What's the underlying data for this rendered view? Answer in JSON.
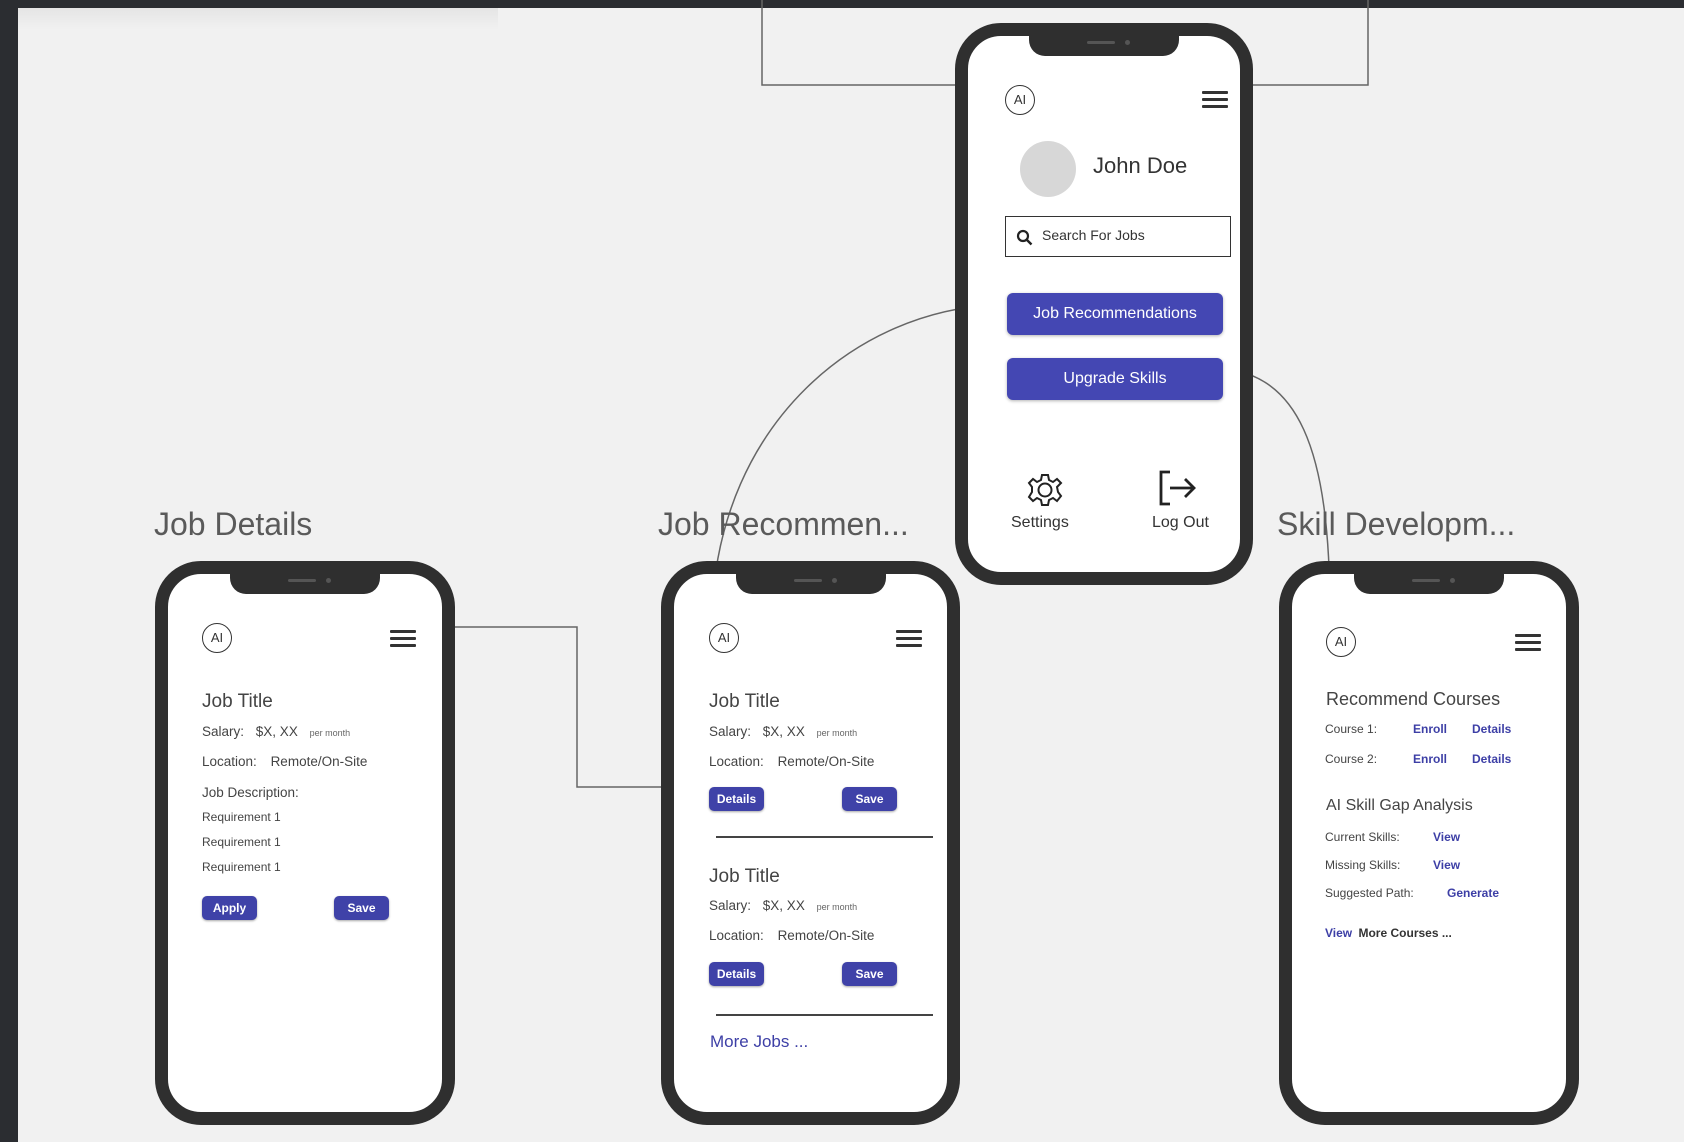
{
  "labels": {
    "job_details": "Job Details",
    "job_recommendations": "Job Recommen...",
    "skill_development": "Skill Developm..."
  },
  "home": {
    "logo": "AI",
    "user_name": "John Doe",
    "search_placeholder": "Search For Jobs",
    "btn_job_recs": "Job Recommendations",
    "btn_upgrade": "Upgrade Skills",
    "settings_label": "Settings",
    "logout_label": "Log Out"
  },
  "job_details": {
    "logo": "AI",
    "title": "Job Title",
    "salary_label": "Salary:",
    "salary_value": "$X, XX",
    "salary_unit": "per month",
    "location_label": "Location:",
    "location_value": "Remote/On-Site",
    "description_label": "Job Description:",
    "requirements": [
      "Requirement 1",
      "Requirement 1",
      "Requirement 1"
    ],
    "apply_label": "Apply",
    "save_label": "Save"
  },
  "job_recs": {
    "logo": "AI",
    "jobs": [
      {
        "title": "Job Title",
        "salary_label": "Salary:",
        "salary_value": "$X, XX",
        "salary_unit": "per month",
        "location_label": "Location:",
        "location_value": "Remote/On-Site",
        "details_label": "Details",
        "save_label": "Save"
      },
      {
        "title": "Job Title",
        "salary_label": "Salary:",
        "salary_value": "$X, XX",
        "salary_unit": "per month",
        "location_label": "Location:",
        "location_value": "Remote/On-Site",
        "details_label": "Details",
        "save_label": "Save"
      }
    ],
    "more_jobs": "More Jobs ..."
  },
  "skills": {
    "logo": "AI",
    "recommend_heading": "Recommend Courses",
    "courses": [
      {
        "label": "Course 1:",
        "enroll": "Enroll",
        "details": "Details"
      },
      {
        "label": "Course 2:",
        "enroll": "Enroll",
        "details": "Details"
      }
    ],
    "gap_heading": "AI Skill Gap Analysis",
    "gap_rows": [
      {
        "label": "Current Skills:",
        "action": "View"
      },
      {
        "label": "Missing Skills:",
        "action": "View"
      },
      {
        "label": "Suggested Path:",
        "action": "Generate"
      }
    ],
    "view_link": "View",
    "more_courses": "More Courses ..."
  },
  "colors": {
    "accent": "#4447b3",
    "frame": "#2f2f2f",
    "canvas": "#f1f1f1",
    "chrome": "#2b2d31"
  }
}
